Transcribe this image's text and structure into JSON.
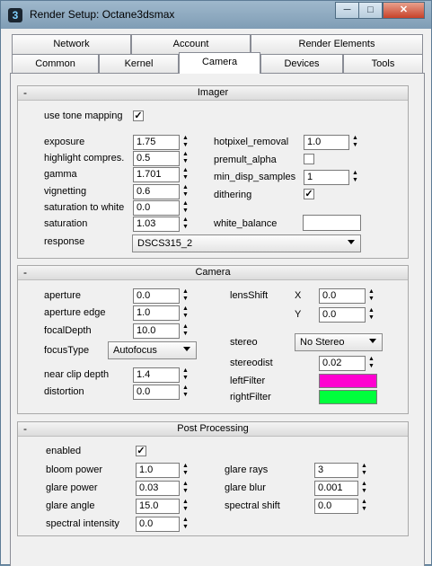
{
  "window": {
    "title": "Render Setup: Octane3dsmax",
    "minimize": "─",
    "maximize": "□",
    "close": "✕"
  },
  "tabs_row1": [
    {
      "label": "Network"
    },
    {
      "label": "Account"
    },
    {
      "label": "Render Elements"
    }
  ],
  "tabs_row2": [
    {
      "label": "Common"
    },
    {
      "label": "Kernel"
    },
    {
      "label": "Camera",
      "active": true
    },
    {
      "label": "Devices"
    },
    {
      "label": "Tools"
    }
  ],
  "imager": {
    "title": "Imager",
    "collapse": "-",
    "use_tone_mapping": {
      "label": "use tone mapping",
      "checked": true
    },
    "exposure": {
      "label": "exposure",
      "value": "1.75"
    },
    "highlight": {
      "label": "highlight compres.",
      "value": "0.5"
    },
    "gamma": {
      "label": "gamma",
      "value": "1.701"
    },
    "vignetting": {
      "label": "vignetting",
      "value": "0.6"
    },
    "sat_white": {
      "label": "saturation to white",
      "value": "0.0"
    },
    "saturation": {
      "label": "saturation",
      "value": "1.03"
    },
    "response": {
      "label": "response",
      "value": "DSCS315_2"
    },
    "hotpixel": {
      "label": "hotpixel_removal",
      "value": "1.0"
    },
    "premult": {
      "label": "premult_alpha",
      "checked": false
    },
    "min_disp": {
      "label": "min_disp_samples",
      "value": "1"
    },
    "dithering": {
      "label": "dithering",
      "checked": true
    },
    "white_balance": {
      "label": "white_balance",
      "color": "#ffffff"
    }
  },
  "camera": {
    "title": "Camera",
    "collapse": "-",
    "aperture": {
      "label": "aperture",
      "value": "0.0"
    },
    "aperture_edge": {
      "label": "aperture edge",
      "value": "1.0"
    },
    "focal_depth": {
      "label": "focalDepth",
      "value": "10.0"
    },
    "focus_type": {
      "label": "focusType",
      "value": "Autofocus"
    },
    "near_clip": {
      "label": "near clip depth",
      "value": "1.4"
    },
    "distortion": {
      "label": "distortion",
      "value": "0.0"
    },
    "lens_shift": {
      "label": "lensShift",
      "x_label": "X",
      "x_value": "0.0",
      "y_label": "Y",
      "y_value": "0.0"
    },
    "stereo": {
      "label": "stereo",
      "value": "No Stereo"
    },
    "stereodist": {
      "label": "stereodist",
      "value": "0.02"
    },
    "left_filter": {
      "label": "leftFilter",
      "color": "#ff00d0"
    },
    "right_filter": {
      "label": "rightFilter",
      "color": "#00ff3c"
    }
  },
  "post": {
    "title": "Post Processing",
    "collapse": "-",
    "enabled": {
      "label": "enabled",
      "checked": true
    },
    "bloom_power": {
      "label": "bloom power",
      "value": "1.0"
    },
    "glare_power": {
      "label": "glare power",
      "value": "0.03"
    },
    "glare_angle": {
      "label": "glare angle",
      "value": "15.0"
    },
    "spectral_intensity": {
      "label": "spectral intensity",
      "value": "0.0"
    },
    "glare_rays": {
      "label": "glare rays",
      "value": "3"
    },
    "glare_blur": {
      "label": "glare blur",
      "value": "0.001"
    },
    "spectral_shift": {
      "label": "spectral shift",
      "value": "0.0"
    }
  }
}
